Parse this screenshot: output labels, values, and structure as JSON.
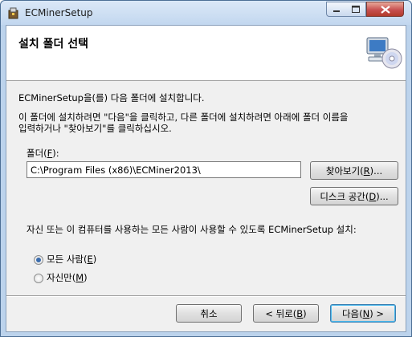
{
  "window": {
    "title": "ECMinerSetup",
    "controls": {
      "minimize": "minimize-button",
      "maximize": "maximize-button",
      "close": "close-button"
    }
  },
  "banner": {
    "title": "설치 폴더 선택",
    "icon": "computer-cd-icon"
  },
  "body": {
    "intro": "ECMinerSetup을(를) 다음 폴더에 설치합니다.",
    "instructions_line1": "이 폴더에 설치하려면 \"다음\"을 클릭하고, 다른 폴더에 설치하려면 아래에 폴더 이름을",
    "instructions_line2": "입력하거나 \"찾아보기\"를 클릭하십시오."
  },
  "folder": {
    "label_prefix": "폴더(",
    "label_key": "F",
    "label_suffix": "):",
    "path_value": "C:\\Program Files (x86)\\ECMiner2013\\",
    "browse_button": {
      "prefix": "찾아보기(",
      "key": "R",
      "suffix": ")..."
    },
    "disk_cost_button": {
      "prefix": "디스크 공간(",
      "key": "D",
      "suffix": ")..."
    }
  },
  "install_for": {
    "question": "자신 또는 이 컴퓨터를 사용하는 모든 사람이 사용할 수 있도록 ECMinerSetup 설치:",
    "everyone": {
      "prefix": "모든 사람(",
      "key": "E",
      "suffix": ")",
      "selected": true
    },
    "just_me": {
      "prefix": "자신만(",
      "key": "M",
      "suffix": ")",
      "selected": false
    }
  },
  "footer": {
    "cancel": "취소",
    "back": {
      "prefix": "< 뒤로(",
      "key": "B",
      "suffix": ")"
    },
    "next": {
      "prefix": "다음(",
      "key": "N",
      "suffix": ") >"
    }
  },
  "colors": {
    "accent": "#3c7fb1",
    "radio_dot": "#3a6cad",
    "close_red": "#c75050"
  }
}
